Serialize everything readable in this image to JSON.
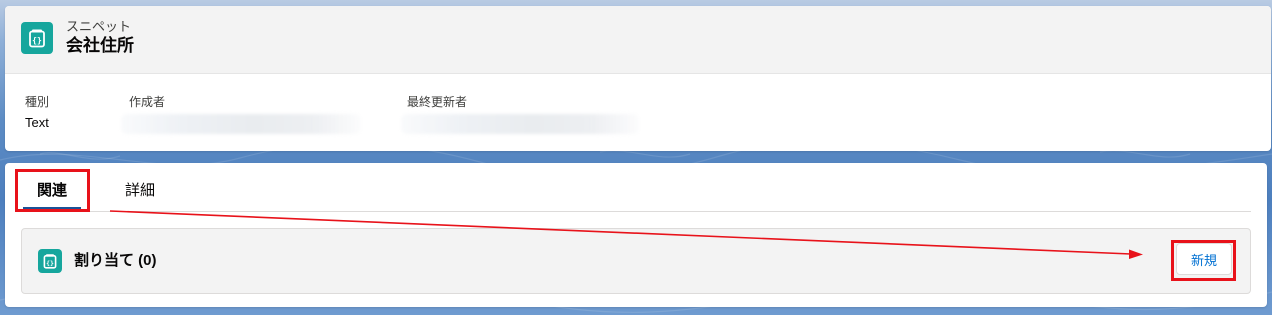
{
  "header": {
    "object_label": "スニペット",
    "record_title": "会社住所",
    "icon": "snippet-icon",
    "icon_color": "#16a69d",
    "fields": [
      {
        "label": "種別",
        "value": "Text"
      },
      {
        "label": "作成者",
        "value": ""
      },
      {
        "label": "最終更新者",
        "value": ""
      }
    ]
  },
  "tabs": [
    {
      "label": "関連",
      "active": true
    },
    {
      "label": "詳細",
      "active": false
    }
  ],
  "related_list": {
    "title": "割り当て (0)",
    "icon": "snippet-icon",
    "new_button_label": "新規"
  },
  "colors": {
    "annotation": "#e8121a",
    "link": "#0070d2",
    "tab_underline": "#1b5297"
  }
}
